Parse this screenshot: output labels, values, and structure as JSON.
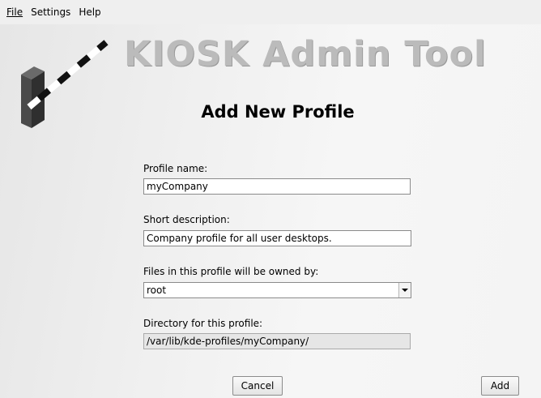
{
  "menubar": {
    "items": [
      {
        "label": "File"
      },
      {
        "label": "Settings"
      },
      {
        "label": "Help"
      }
    ]
  },
  "header": {
    "app_title": "KIOSK Admin Tool",
    "page_title": "Add New Profile"
  },
  "form": {
    "profile_name": {
      "label": "Profile name:",
      "value": "myCompany"
    },
    "short_description": {
      "label": "Short description:",
      "value": "Company profile for all user desktops."
    },
    "owner": {
      "label": "Files in this profile will be owned by:",
      "value": "root"
    },
    "directory": {
      "label": "Directory for this profile:",
      "value": "/var/lib/kde-profiles/myCompany/"
    }
  },
  "buttons": {
    "cancel": "Cancel",
    "add": "Add"
  },
  "colors": {
    "title_gray": "#bbbbbb",
    "background": "#efefef"
  }
}
